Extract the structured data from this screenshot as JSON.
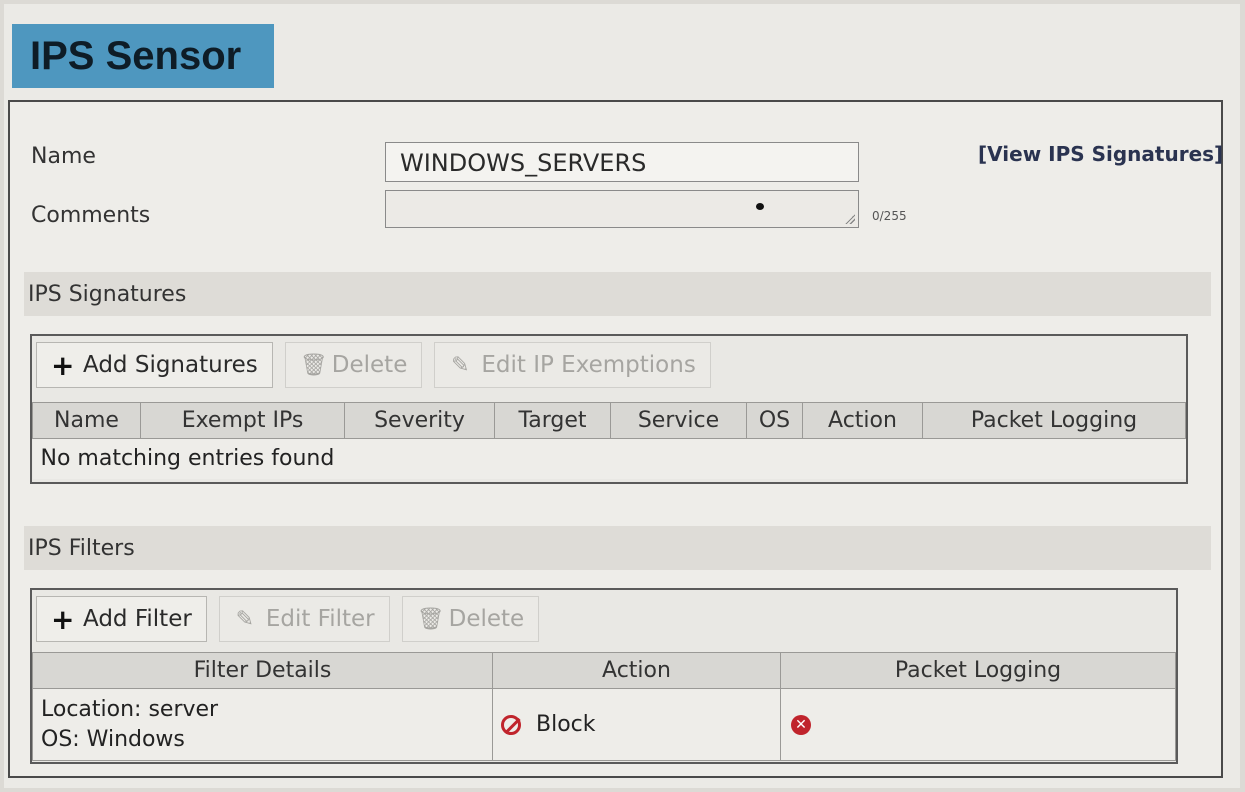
{
  "title": "IPS Sensor",
  "form": {
    "name_label": "Name",
    "name_value": "WINDOWS_SERVERS",
    "comments_label": "Comments",
    "comments_counter": "0/255",
    "view_link": "[View IPS Signatures]"
  },
  "signatures": {
    "section_title": "IPS Signatures",
    "toolbar": {
      "add": "Add Signatures",
      "delete": "Delete",
      "edit_exemptions": "Edit IP Exemptions"
    },
    "columns": [
      "Name",
      "Exempt IPs",
      "Severity",
      "Target",
      "Service",
      "OS",
      "Action",
      "Packet Logging"
    ],
    "empty_message": "No matching entries found"
  },
  "filters": {
    "section_title": "IPS Filters",
    "toolbar": {
      "add": "Add Filter",
      "edit": "Edit Filter",
      "delete": "Delete"
    },
    "columns": [
      "Filter Details",
      "Action",
      "Packet Logging"
    ],
    "rows": [
      {
        "details_line1": "Location: server",
        "details_line2": "OS: Windows",
        "action": "Block",
        "action_icon": "block-icon",
        "packet_logging_icon": "disabled-x-icon"
      }
    ]
  },
  "colors": {
    "title_tab": "#4e97bf",
    "block_red": "#c0242c"
  }
}
